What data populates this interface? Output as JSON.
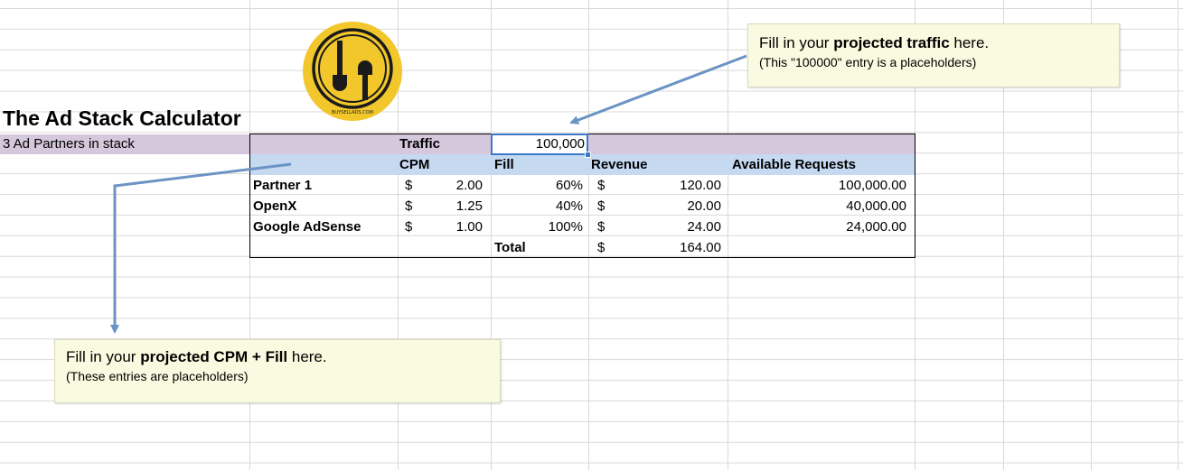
{
  "title": "The Ad Stack Calculator",
  "subtitle": "3 Ad Partners in stack",
  "logo_text": "BUYSELLADS.COM",
  "traffic": {
    "label": "Traffic",
    "value": "100,000"
  },
  "headers": {
    "cpm": "CPM",
    "fill": "Fill",
    "revenue": "Revenue",
    "available": "Available Requests"
  },
  "rows": [
    {
      "name": "Partner 1",
      "cpm_cur": "$",
      "cpm": "2.00",
      "fill": "60%",
      "rev_cur": "$",
      "revenue": "120.00",
      "available": "100,000.00"
    },
    {
      "name": "OpenX",
      "cpm_cur": "$",
      "cpm": "1.25",
      "fill": "40%",
      "rev_cur": "$",
      "revenue": "20.00",
      "available": "40,000.00"
    },
    {
      "name": "Google AdSense",
      "cpm_cur": "$",
      "cpm": "1.00",
      "fill": "100%",
      "rev_cur": "$",
      "revenue": "24.00",
      "available": "24,000.00"
    }
  ],
  "total": {
    "label": "Total",
    "cur": "$",
    "value": "164.00"
  },
  "note_traffic": {
    "pre": "Fill in your ",
    "bold": "projected traffic",
    "post": " here.",
    "sub": "(This \"100000\" entry is a placeholders)"
  },
  "note_cpm": {
    "pre": "Fill in your ",
    "bold": "projected CPM + Fill",
    "post": " here.",
    "sub": "(These entries are placeholders)"
  },
  "colors": {
    "purple_band": "#d5c7dc",
    "blue_band": "#c5d9f1",
    "note_bg": "#fafae0",
    "arrow": "#6b93c4",
    "logo_yellow": "#f2c72c"
  }
}
